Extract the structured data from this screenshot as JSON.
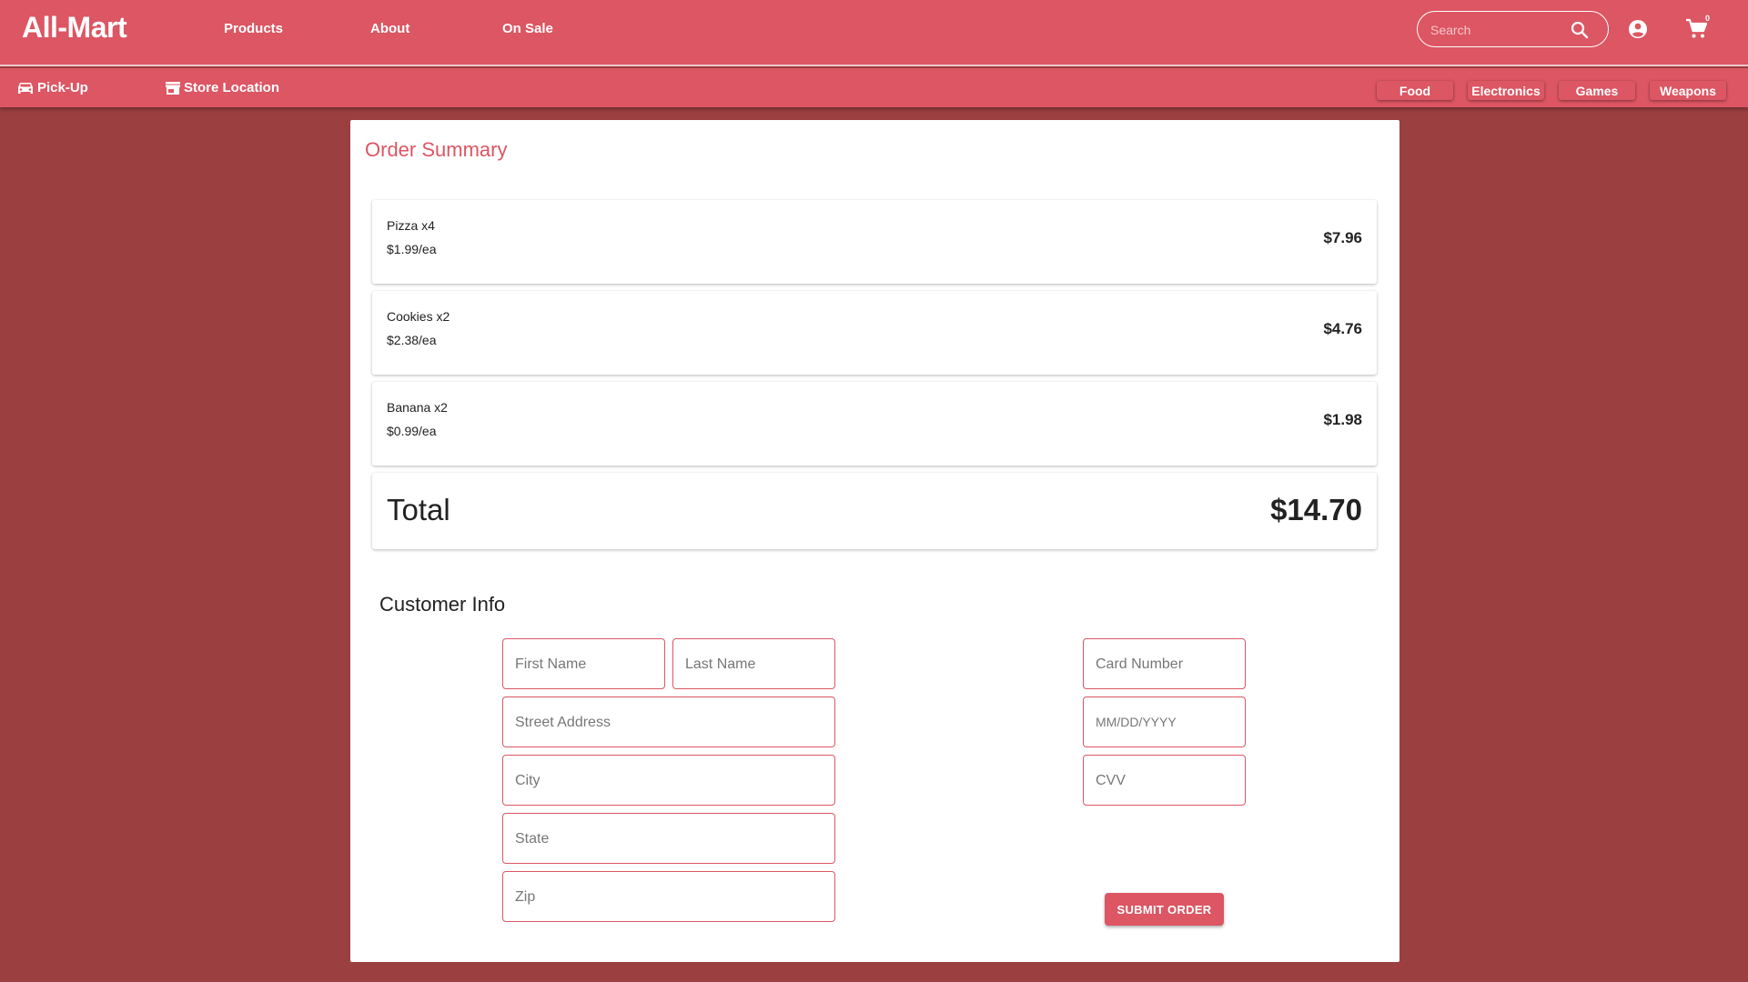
{
  "header": {
    "brand": "All-Mart",
    "nav": [
      {
        "label": "Products"
      },
      {
        "label": "About"
      },
      {
        "label": "On Sale"
      }
    ],
    "search_placeholder": "Search",
    "cart_count": "0"
  },
  "subnav": {
    "left": [
      {
        "label": "Pick-Up",
        "icon": "car-icon"
      },
      {
        "label": "Store Location",
        "icon": "store-icon"
      }
    ],
    "categories": [
      {
        "label": "Food"
      },
      {
        "label": "Electronics"
      },
      {
        "label": "Games"
      },
      {
        "label": "Weapons"
      }
    ]
  },
  "order": {
    "title": "Order Summary",
    "items": [
      {
        "name": "Pizza x4",
        "unit": "$1.99/ea",
        "price": "$7.96"
      },
      {
        "name": "Cookies x2",
        "unit": "$2.38/ea",
        "price": "$4.76"
      },
      {
        "name": "Banana x2",
        "unit": "$0.99/ea",
        "price": "$1.98"
      }
    ],
    "total_label": "Total",
    "total_value": "$14.70"
  },
  "customer": {
    "title": "Customer Info",
    "fields": {
      "first_name": "First Name",
      "last_name": "Last Name",
      "street": "Street Address",
      "city": "City",
      "state": "State",
      "zip": "Zip",
      "card_number": "Card Number",
      "expiry": "MM/DD/YYYY",
      "cvv": "CVV"
    },
    "submit_label": "Submit Order"
  },
  "colors": {
    "brand": "#dc5663",
    "background": "#9c3f40",
    "card": "#ffffff"
  }
}
